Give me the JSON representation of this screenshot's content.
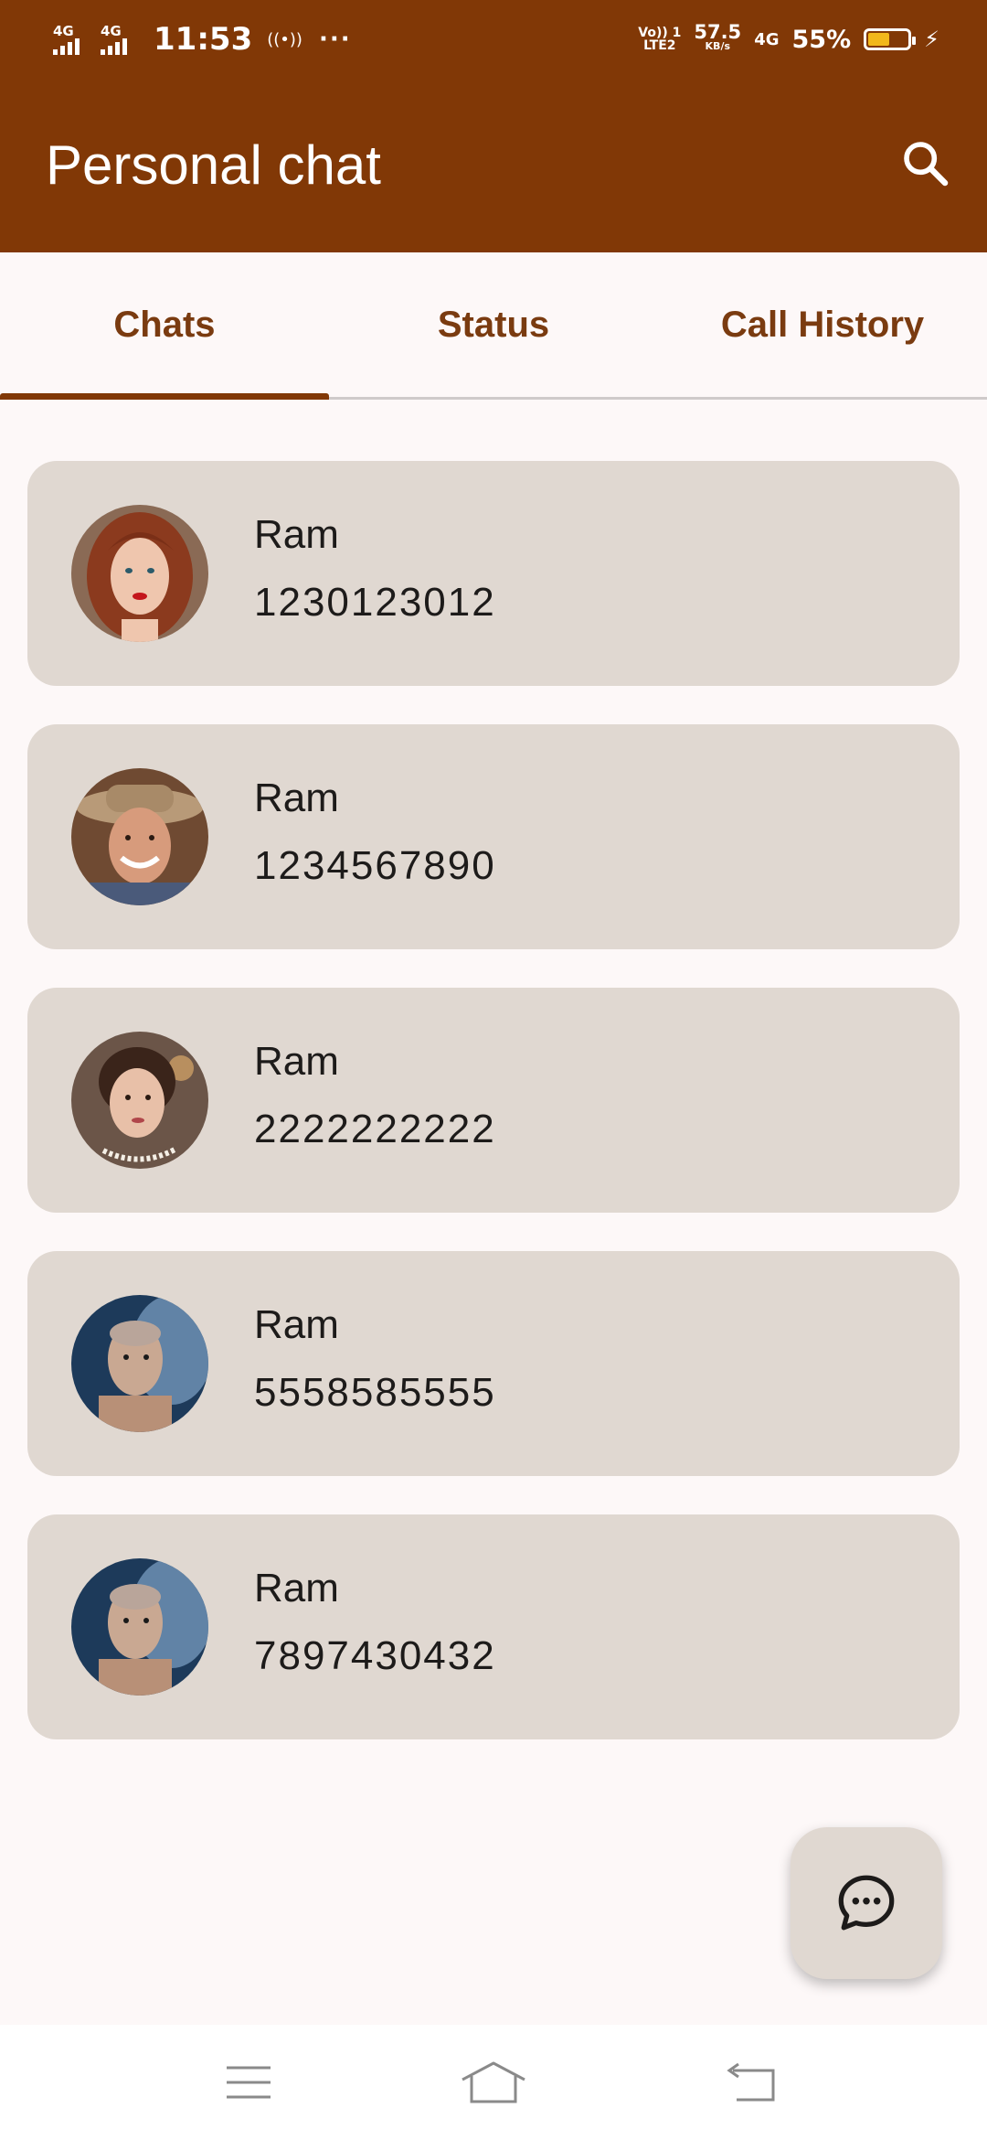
{
  "status_bar": {
    "sim1": "4G",
    "sim2": "4G",
    "time": "11:53",
    "hotspot": "((•))",
    "more": "···",
    "volte_top": "Vo)) 1",
    "volte_bottom": "LTE2",
    "speed_value": "57.5",
    "speed_unit": "KB/s",
    "network": "4G",
    "battery_percent": "55%",
    "battery_level": 0.55
  },
  "app_bar": {
    "title": "Personal chat"
  },
  "tabs": [
    {
      "label": "Chats",
      "selected": true
    },
    {
      "label": "Status",
      "selected": false
    },
    {
      "label": "Call History",
      "selected": false
    }
  ],
  "contacts": [
    {
      "name": "Ram",
      "phone": "1230123012",
      "avatar": "avatar-woman-red-hair"
    },
    {
      "name": "Ram",
      "phone": "1234567890",
      "avatar": "avatar-man-hat"
    },
    {
      "name": "Ram",
      "phone": "2222222222",
      "avatar": "avatar-woman-pearls"
    },
    {
      "name": "Ram",
      "phone": "5558585555",
      "avatar": "avatar-man-smoke"
    },
    {
      "name": "Ram",
      "phone": "7897430432",
      "avatar": "avatar-man-smoke"
    }
  ],
  "colors": {
    "primary": "#813806",
    "card": "#e0d8d1",
    "background": "#fdf8f8",
    "battery": "#f2b81b"
  },
  "icons": {
    "search": "search-icon",
    "fab": "chat-bubble-icon",
    "nav_menu": "menu-icon",
    "nav_home": "home-icon",
    "nav_back": "back-icon"
  }
}
